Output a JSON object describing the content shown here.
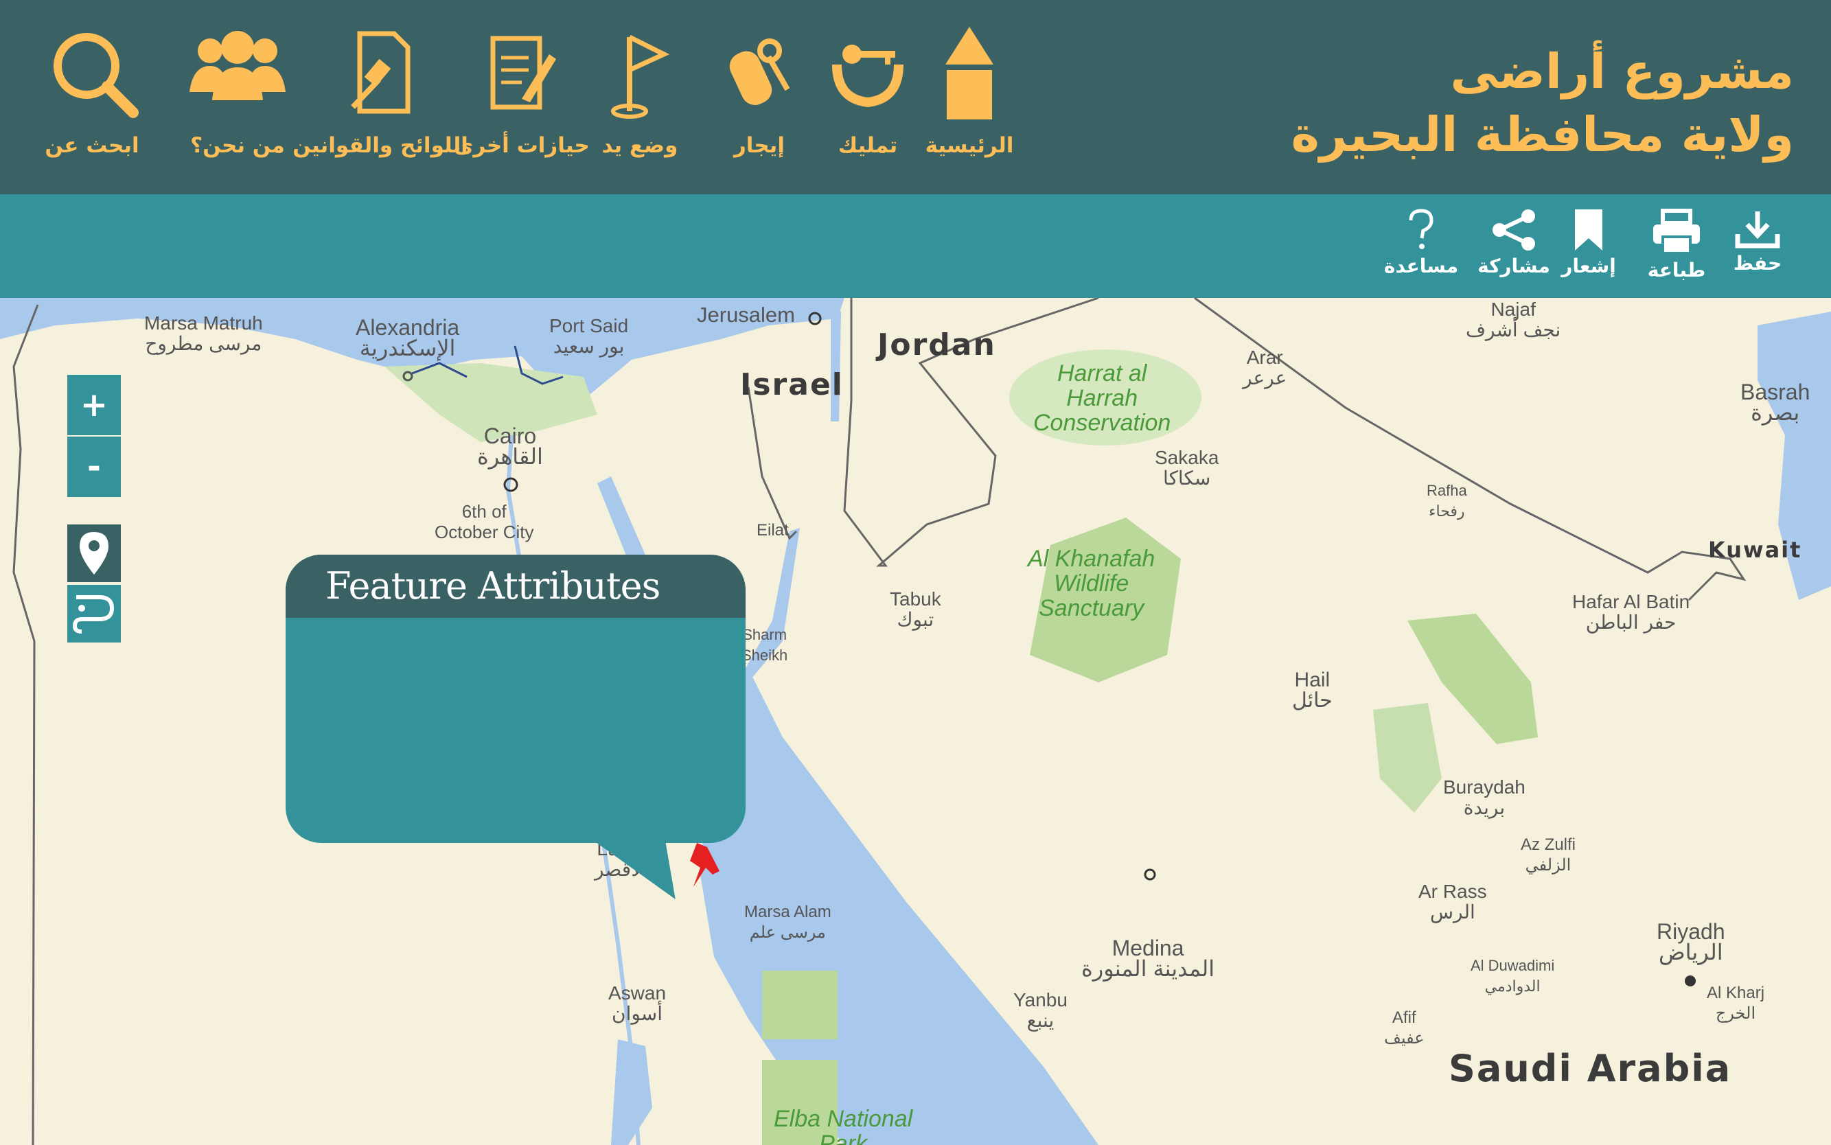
{
  "header": {
    "title_line1": "مشروع أراضى",
    "title_line2": "ولاية محافظة البحيرة",
    "nav": [
      {
        "label": "الرئيسية",
        "icon": "home-icon"
      },
      {
        "label": "تمليك",
        "icon": "ownership-icon"
      },
      {
        "label": "إيجار",
        "icon": "rent-icon"
      },
      {
        "label": "وضع يد",
        "icon": "flag-icon"
      },
      {
        "label": "حيازات أخرى",
        "icon": "document-pen-icon"
      },
      {
        "label": "اللوائح والقوانين",
        "icon": "law-document-icon"
      },
      {
        "label": "من نحن؟",
        "icon": "users-icon"
      },
      {
        "label": "ابحث عن",
        "icon": "search-icon"
      }
    ]
  },
  "toolbar": {
    "tools": [
      {
        "label": "حفظ",
        "icon": "download-icon"
      },
      {
        "label": "طباعة",
        "icon": "print-icon"
      },
      {
        "label": "إشعار",
        "icon": "bookmark-icon"
      },
      {
        "label": "مشاركة",
        "icon": "share-icon"
      },
      {
        "label": "مساعدة",
        "icon": "help-icon"
      }
    ]
  },
  "map_controls": {
    "zoom_in": "+",
    "zoom_out": "-"
  },
  "popup": {
    "title": "Feature Attributes"
  },
  "map_labels": {
    "marsa_matruh": "Marsa Matruh",
    "marsa_matruh_ar": "مرسى مطروح",
    "alexandria": "Alexandria",
    "alexandria_ar": "الإسكندرية",
    "port_said": "Port Said",
    "port_said_ar": "بور سعيد",
    "jerusalem": "Jerusalem",
    "jordan": "Jordan",
    "israel": "Israel",
    "cairo": "Cairo",
    "cairo_ar": "القاهرة",
    "october": "6th of",
    "october2": "October City",
    "eilat": "Eilat",
    "harrat": "Harrat al",
    "harrat2": "Harrah",
    "harrat3": "Conservation",
    "arar": "Arar",
    "arar_ar": "عرعر",
    "sakaka": "Sakaka",
    "sakaka_ar": "سكاكا",
    "najaf": "Najaf",
    "najaf_ar": "نجف أشرف",
    "basrah": "Basrah",
    "basrah_ar": "بصرة",
    "rafha": "Rafha",
    "rafha_ar": "رفحاء",
    "kuwait": "Kuwait",
    "tabuk": "Tabuk",
    "tabuk_ar": "تبوك",
    "khanafah": "Al Khanafah",
    "khanafah2": "Wildlife",
    "khanafah3": "Sanctuary",
    "hafar": "Hafar Al Batin",
    "hafar_ar": "حفر الباطن",
    "hail": "Hail",
    "hail_ar": "حائل",
    "buraydah": "Buraydah",
    "buraydah_ar": "بريدة",
    "zulfi": "Az Zulfi",
    "zulfi_ar": "الزلفي",
    "arrass": "Ar Rass",
    "arrass_ar": "الرس",
    "luxor": "Luxor",
    "luxor_ar": "الأقصر",
    "marsa_alam": "Marsa Alam",
    "marsa_alam_ar": "مرسى علم",
    "medina": "Medina",
    "medina_ar": "المدينة المنورة",
    "riyadh": "Riyadh",
    "riyadh_ar": "الرياض",
    "duwadimi": "Al Duwadimi",
    "duwadimi_ar": "الدوادمي",
    "kharj": "Al Kharj",
    "kharj_ar": "الخرج",
    "aswan": "Aswan",
    "aswan_ar": "أسوان",
    "yanbu": "Yanbu",
    "yanbu_ar": "ينبع",
    "afif": "Afif",
    "afif_ar": "عفيف",
    "saudi": "Saudi Arabia",
    "elba": "Elba National",
    "elba2": "Park",
    "sharm": "Sharm",
    "sharm2": "Sheikh"
  },
  "colors": {
    "header_bg": "#3a6264",
    "toolbar_bg": "#34929a",
    "accent": "#fdbe57",
    "water": "#a8c8ec",
    "land": "#f6f1dc",
    "park": "#b9d89a"
  }
}
